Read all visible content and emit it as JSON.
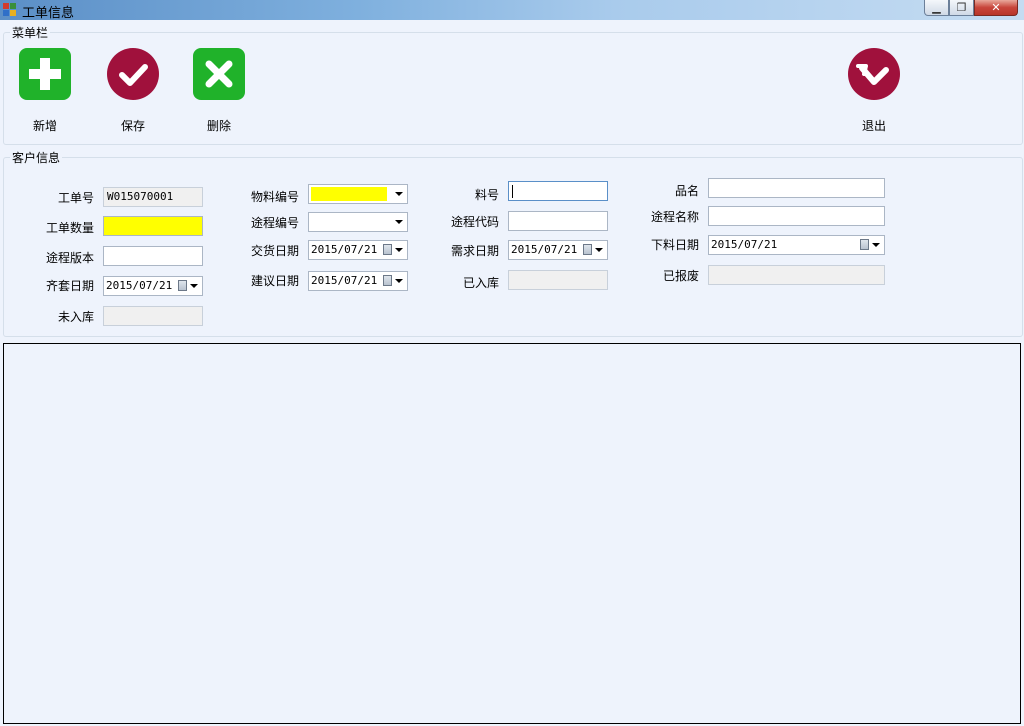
{
  "window": {
    "title": "工单信息",
    "controls": [
      "minimize",
      "restore",
      "close"
    ]
  },
  "toolbar": {
    "legend": "菜单栏",
    "buttons": [
      {
        "id": "new",
        "label": "新增",
        "icon": "plus-icon",
        "color": "#20b22a"
      },
      {
        "id": "save",
        "label": "保存",
        "icon": "checkmark-icon",
        "color": "#a0113c"
      },
      {
        "id": "delete",
        "label": "删除",
        "icon": "x-icon",
        "color": "#20b22a"
      },
      {
        "id": "exit",
        "label": "退出",
        "icon": "exit-arrow-icon",
        "color": "#a0113c"
      }
    ]
  },
  "customer": {
    "legend": "客户信息",
    "fields": {
      "work_order_no": {
        "label": "工单号",
        "value": "W015070001"
      },
      "work_order_qty": {
        "label": "工单数量",
        "value": ""
      },
      "route_version": {
        "label": "途程版本",
        "value": ""
      },
      "kit_date": {
        "label": "齐套日期",
        "value": "2015/07/21"
      },
      "not_in_stock": {
        "label": "未入库",
        "value": ""
      },
      "material_code": {
        "label": "物料编号",
        "value": ""
      },
      "route_code": {
        "label": "途程编号",
        "value": ""
      },
      "delivery_date": {
        "label": "交货日期",
        "value": "2015/07/21"
      },
      "suggested_date": {
        "label": "建议日期",
        "value": "2015/07/21"
      },
      "part_no": {
        "label": "料号",
        "value": ""
      },
      "route_id": {
        "label": "途程代码",
        "value": ""
      },
      "demand_date": {
        "label": "需求日期",
        "value": "2015/07/21"
      },
      "in_stock": {
        "label": "已入库",
        "value": ""
      },
      "product_name": {
        "label": "品名",
        "value": ""
      },
      "route_name": {
        "label": "途程名称",
        "value": ""
      },
      "feed_date": {
        "label": "下料日期",
        "value": "2015/07/21"
      },
      "scrapped": {
        "label": "已报废",
        "value": ""
      }
    },
    "colors": {
      "required": "#ffff00",
      "readonly": "#f0f0f0"
    }
  }
}
